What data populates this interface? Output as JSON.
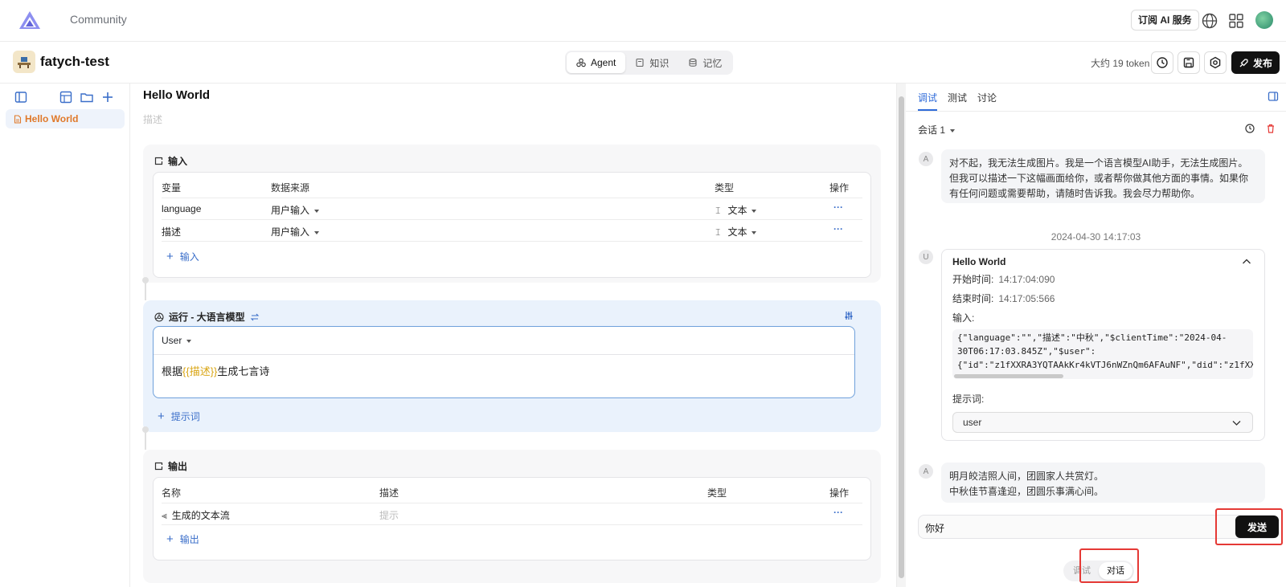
{
  "topbar": {
    "brand": "Community",
    "subscribe_label": "订阅 AI 服务"
  },
  "project": {
    "name": "fatych-test",
    "tabs": [
      {
        "label": "Agent",
        "active": true
      },
      {
        "label": "知识",
        "active": false
      },
      {
        "label": "记忆",
        "active": false
      }
    ],
    "token_text": "大约 19 token",
    "publish_label": "发布"
  },
  "sidebar": {
    "files": [
      {
        "label": "Hello World",
        "selected": true
      }
    ]
  },
  "agent": {
    "title": "Hello World",
    "description_placeholder": "描述",
    "input": {
      "title": "输入",
      "headers": [
        "变量",
        "数据来源",
        "类型",
        "操作"
      ],
      "rows": [
        {
          "variable": "language",
          "source": "用户输入",
          "type": "文本",
          "action": "···"
        },
        {
          "variable": "描述",
          "source": "用户输入",
          "type": "文本",
          "action": "···"
        }
      ],
      "add_label": "输入"
    },
    "run": {
      "title": "运行 - 大语言模型",
      "role": "User",
      "prompt_prefix": "根据",
      "prompt_var": "{{描述}}",
      "prompt_suffix": "生成七言诗",
      "add_label": "提示词"
    },
    "output": {
      "title": "输出",
      "headers": [
        "名称",
        "描述",
        "类型",
        "操作"
      ],
      "rows": [
        {
          "name": "生成的文本流",
          "desc_placeholder": "提示",
          "action": "···"
        }
      ],
      "add_label": "输出"
    }
  },
  "debug": {
    "tabs": [
      {
        "label": "调试",
        "active": true
      },
      {
        "label": "测试",
        "active": false
      },
      {
        "label": "讨论",
        "active": false
      }
    ],
    "session": "会话 1",
    "messages": {
      "first": {
        "avatar": "A",
        "text": "对不起，我无法生成图片。我是一个语言模型AI助手，无法生成图片。但我可以描述一下这幅画面给你，或者帮你做其他方面的事情。如果你有任何问题或需要帮助，请随时告诉我。我会尽力帮助你。"
      },
      "timestamp": "2024-04-30 14:17:03",
      "trace": {
        "avatar": "U",
        "title": "Hello World",
        "start_label": "开始时间:",
        "start_value": "14:17:04:090",
        "end_label": "结束时间:",
        "end_value": "14:17:05:566",
        "input_label": "输入:",
        "input_line1": "{\"language\":\"\",\"描述\":\"中秋\",\"$clientTime\":\"2024-04-",
        "input_line2": "30T06:17:03.845Z\",\"$user\":",
        "input_line3": "{\"id\":\"z1fXXRA3YQTAAkKr4kVTJ6nWZnQm6AFAuNF\",\"did\":\"z1fXXRA",
        "prompt_label": "提示词:",
        "prompt_value": "user"
      },
      "reply": {
        "avatar": "A",
        "line1": "明月皎洁照人间，团圆家人共赏灯。",
        "line2": "中秋佳节喜逢迎，团圆乐事满心间。"
      }
    },
    "input_value": "你好",
    "send_label": "发送",
    "modes": [
      {
        "label": "调试",
        "active": false
      },
      {
        "label": "对话",
        "active": true
      }
    ]
  },
  "colors": {
    "accent": "#2f6bd9",
    "highlight_box": "#e53935",
    "variable": "#d9a514",
    "file_label": "#e0792a"
  }
}
